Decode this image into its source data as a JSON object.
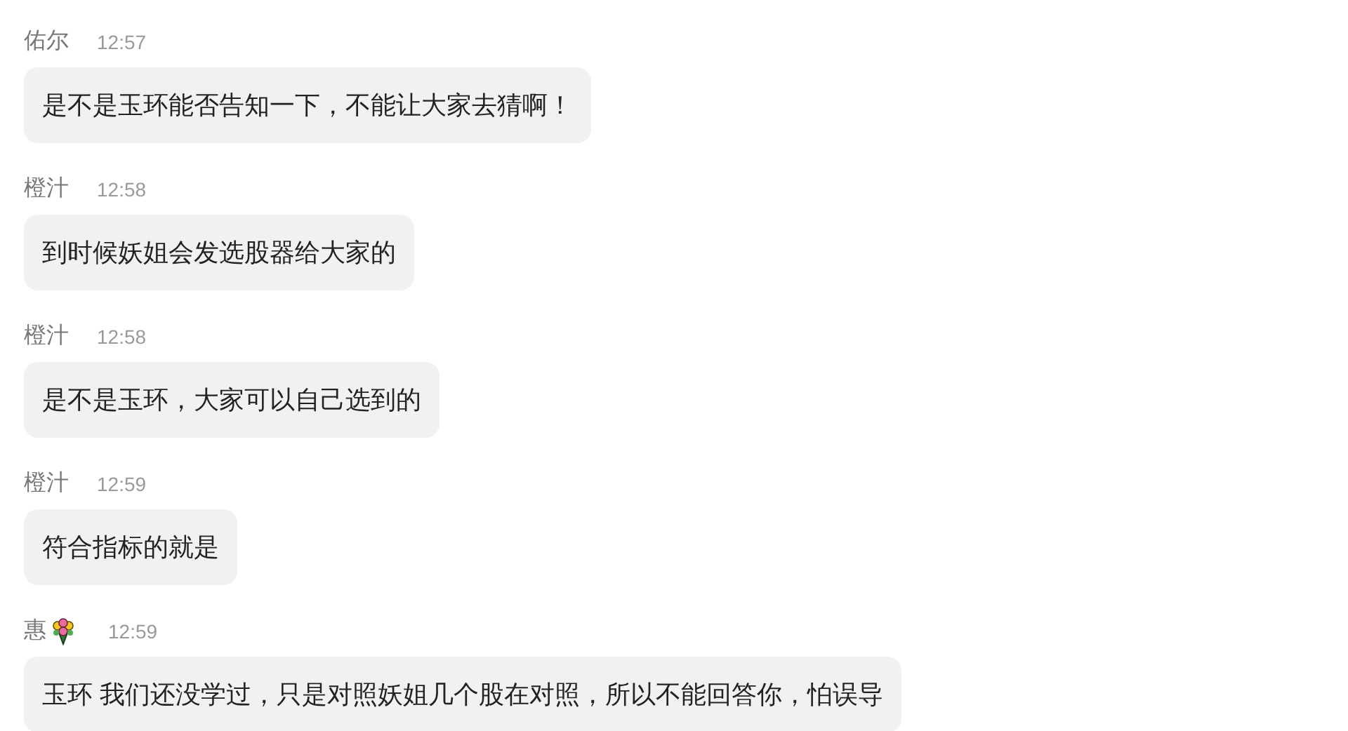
{
  "messages": [
    {
      "sender": "佑尔",
      "name_icon": false,
      "time": "12:57",
      "text": "是不是玉环能否告知一下，不能让大家去猜啊！"
    },
    {
      "sender": "橙汁",
      "name_icon": false,
      "time": "12:58",
      "text": "到时候妖姐会发选股器给大家的"
    },
    {
      "sender": "橙汁",
      "name_icon": false,
      "time": "12:58",
      "text": "是不是玉环，大家可以自己选到的"
    },
    {
      "sender": "橙汁",
      "name_icon": false,
      "time": "12:59",
      "text": "符合指标的就是"
    },
    {
      "sender": "惠",
      "name_icon": true,
      "time": "12:59",
      "text": "玉环 我们还没学过，只是对照妖姐几个股在对照，所以不能回答你，怕误导"
    }
  ]
}
